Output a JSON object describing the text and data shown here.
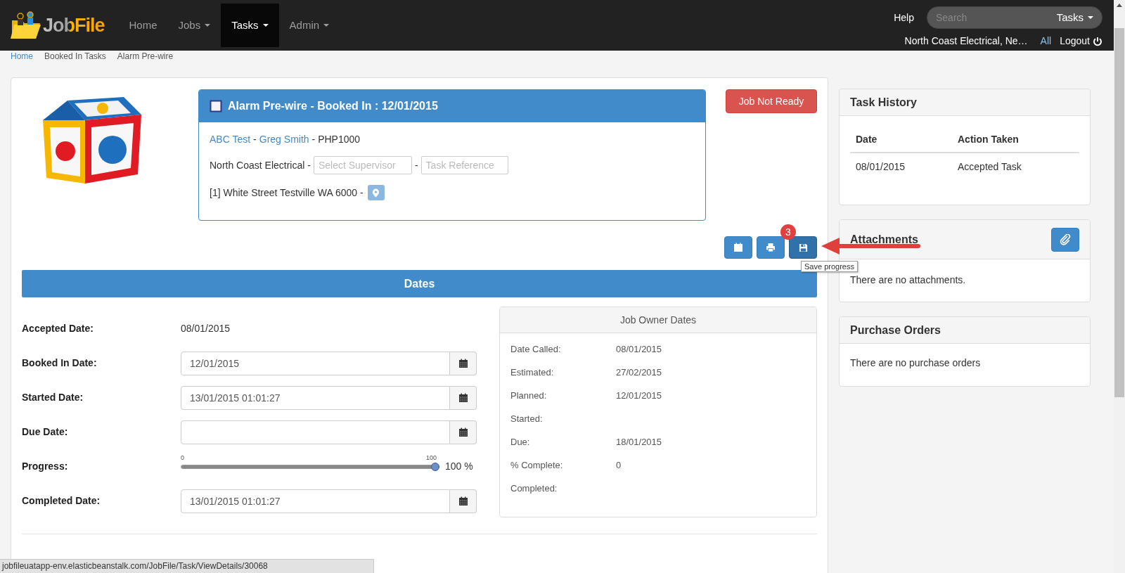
{
  "navbar": {
    "logo": "JobFile",
    "items": [
      {
        "label": "Home",
        "selected": false,
        "dropdown": false
      },
      {
        "label": "Jobs",
        "selected": false,
        "dropdown": true
      },
      {
        "label": "Tasks",
        "selected": true,
        "dropdown": true
      },
      {
        "label": "Admin",
        "selected": false,
        "dropdown": true
      }
    ],
    "help": "Help",
    "search": {
      "placeholder": "Search",
      "scope": "Tasks"
    },
    "company": "North Coast Electrical, Ne…",
    "all": "All",
    "logout": "Logout"
  },
  "breadcrumb": [
    {
      "label": "Home",
      "link": true
    },
    {
      "label": "Booked In Tasks",
      "link": false
    },
    {
      "label": "Alarm Pre-wire",
      "link": false
    }
  ],
  "task_card": {
    "title": "Alarm Pre-wire - Booked In : 12/01/2015",
    "line_1": [
      {
        "text": "ABC Test",
        "link": true
      },
      {
        "text": "-",
        "link": false
      },
      {
        "text": "Greg Smith",
        "link": true
      },
      {
        "text": "- PHP1000",
        "link": false
      }
    ],
    "company": "North Coast Electrical -",
    "supervisor_placeholder": "Select Supervisor",
    "separator": "-",
    "reference_placeholder": "Task Reference",
    "address": "[1] White Street Testville WA 6000 -"
  },
  "status_button": "Job Not Ready",
  "toolbar": [
    {
      "kind": "calendar",
      "selected": false
    },
    {
      "kind": "print",
      "selected": false
    },
    {
      "kind": "save",
      "selected": true,
      "badge": "3",
      "tooltip": "Save progress"
    }
  ],
  "dates": {
    "title": "Dates",
    "rows": [
      {
        "label": "Accepted Date:",
        "kind": "text",
        "value": "08/01/2015"
      },
      {
        "label": "Booked In Date:",
        "kind": "date",
        "value": "12/01/2015"
      },
      {
        "label": "Started Date:",
        "kind": "date",
        "value": "13/01/2015 01:01:27"
      },
      {
        "label": "Due Date:",
        "kind": "date"
      },
      {
        "label": "Progress:",
        "kind": "slider",
        "level": 1,
        "min": "0",
        "max": "100",
        "reading": "100 %"
      },
      {
        "label": "Completed Date:",
        "kind": "date",
        "value": "13/01/2015 01:01:27"
      }
    ]
  },
  "job_owner_dates": {
    "title": "Job Owner Dates",
    "rows": [
      {
        "label": "Date Called:",
        "value": "08/01/2015"
      },
      {
        "label": "Estimated:",
        "value": "27/02/2015"
      },
      {
        "label": "Planned:",
        "value": "12/01/2015"
      },
      {
        "label": "Started:"
      },
      {
        "label": "Due:",
        "value": "18/01/2015"
      },
      {
        "label": "% Complete:",
        "value": "0"
      },
      {
        "label": "Completed:"
      }
    ]
  },
  "task_history": {
    "title": "Task History",
    "columns": [
      "Date",
      "Action Taken"
    ],
    "rows": [
      [
        "08/01/2015",
        "Accepted Task"
      ]
    ]
  },
  "attachments": {
    "title": "Attachments",
    "empty_text": "There are no attachments."
  },
  "purchase_orders": {
    "title": "Purchase Orders",
    "empty_text": "There are no purchase orders"
  },
  "status_bar": "jobfileuatapp-env.elasticbeanstalk.com/JobFile/Task/ViewDetails/30068"
}
